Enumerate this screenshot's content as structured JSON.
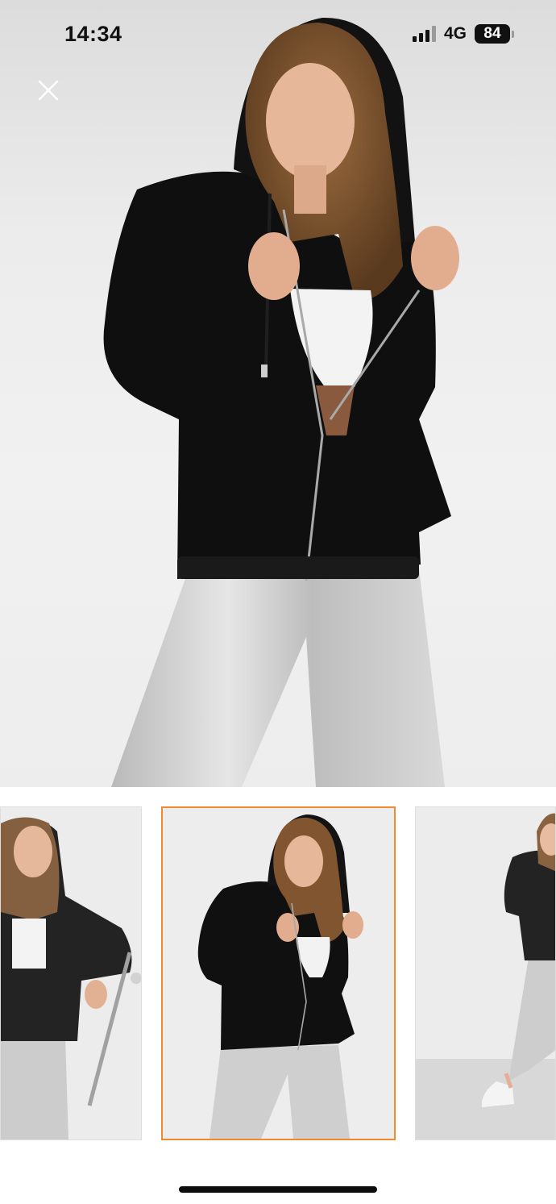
{
  "status_bar": {
    "time": "14:34",
    "network": "4G",
    "battery": "84"
  },
  "icons": {
    "close": "close-icon",
    "signal": "signal-icon",
    "battery": "battery-icon"
  },
  "colors": {
    "selected_thumbnail_border": "#ef8a2e",
    "hoodie": "#0f0f0f",
    "pants": "#c9c9c9",
    "background": "#ffffff"
  },
  "gallery": {
    "selected_index": 1,
    "thumbnail_count": 3
  }
}
